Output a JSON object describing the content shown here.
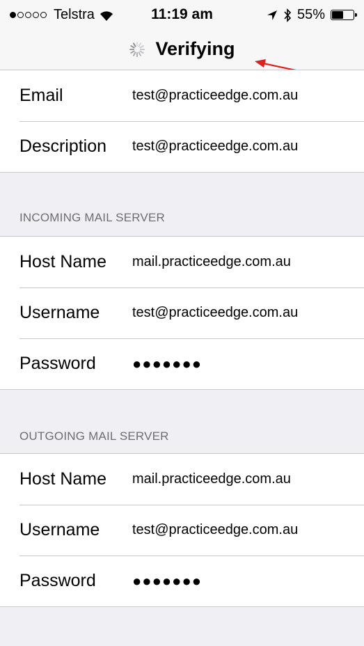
{
  "status_bar": {
    "signal_filled": 1,
    "signal_total": 5,
    "carrier": "Telstra",
    "time": "11:19 am",
    "battery": "55%",
    "battery_level": 0.55,
    "icons": [
      "wifi-icon",
      "location-arrow-icon",
      "bluetooth-icon",
      "battery-icon"
    ]
  },
  "nav": {
    "title": "Verifying",
    "spinner_icon": "activity-spinner-icon"
  },
  "annotation": {
    "arrow_color": "#e0201b"
  },
  "account": {
    "rows": [
      {
        "label": "Email",
        "value": "test@practiceedge.com.au"
      },
      {
        "label": "Description",
        "value": "test@practiceedge.com.au"
      }
    ]
  },
  "incoming": {
    "header": "INCOMING MAIL SERVER",
    "rows": [
      {
        "label": "Host Name",
        "value": "mail.practiceedge.com.au"
      },
      {
        "label": "Username",
        "value": "test@practiceedge.com.au"
      },
      {
        "label": "Password",
        "value": "●●●●●●●"
      }
    ]
  },
  "outgoing": {
    "header": "OUTGOING MAIL SERVER",
    "rows": [
      {
        "label": "Host Name",
        "value": "mail.practiceedge.com.au"
      },
      {
        "label": "Username",
        "value": "test@practiceedge.com.au"
      },
      {
        "label": "Password",
        "value": "●●●●●●●"
      }
    ]
  },
  "colors": {
    "background": "#efeff4",
    "separator": "#c8c7cc",
    "section_header": "#6d6d72"
  }
}
